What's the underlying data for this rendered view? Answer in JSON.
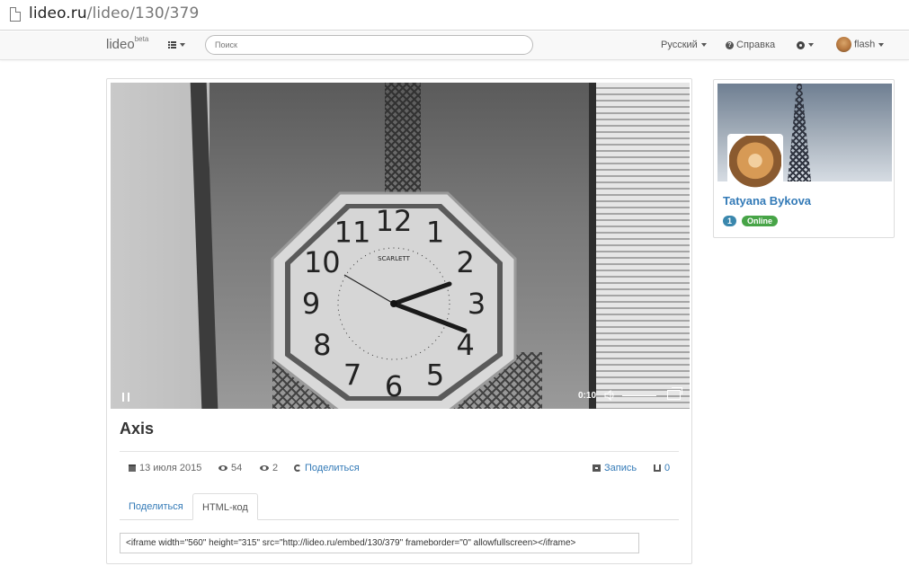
{
  "browser": {
    "url_host": "lideo.ru",
    "url_path": "/lideo/130/379"
  },
  "navbar": {
    "brand": "lideo",
    "brand_sup": "beta",
    "search_placeholder": "Поиск",
    "language": "Русский",
    "help": "Справка",
    "user": "flash"
  },
  "video": {
    "time": "0:10",
    "clock_numbers": [
      "12",
      "1",
      "2",
      "3",
      "4",
      "5",
      "6",
      "7",
      "8",
      "9",
      "10",
      "11"
    ],
    "clock_brand": "SCARLETT"
  },
  "content": {
    "title": "Axis",
    "date": "13 июля 2015",
    "views": "54",
    "watching": "2",
    "share_link": "Поделиться",
    "record_link": "Запись",
    "likes": "0",
    "tabs": [
      "Поделиться",
      "HTML-код"
    ],
    "embed_code": "<iframe width=\"560\" height=\"315\" src=\"http://lideo.ru/embed/130/379\" frameborder=\"0\" allowfullscreen></iframe>"
  },
  "profile": {
    "name": "Tatyana Bykova",
    "count": "1",
    "status": "Online"
  },
  "colors": {
    "link": "#337ab7",
    "badge_blue": "#3a87ad",
    "badge_green": "#47a447"
  }
}
